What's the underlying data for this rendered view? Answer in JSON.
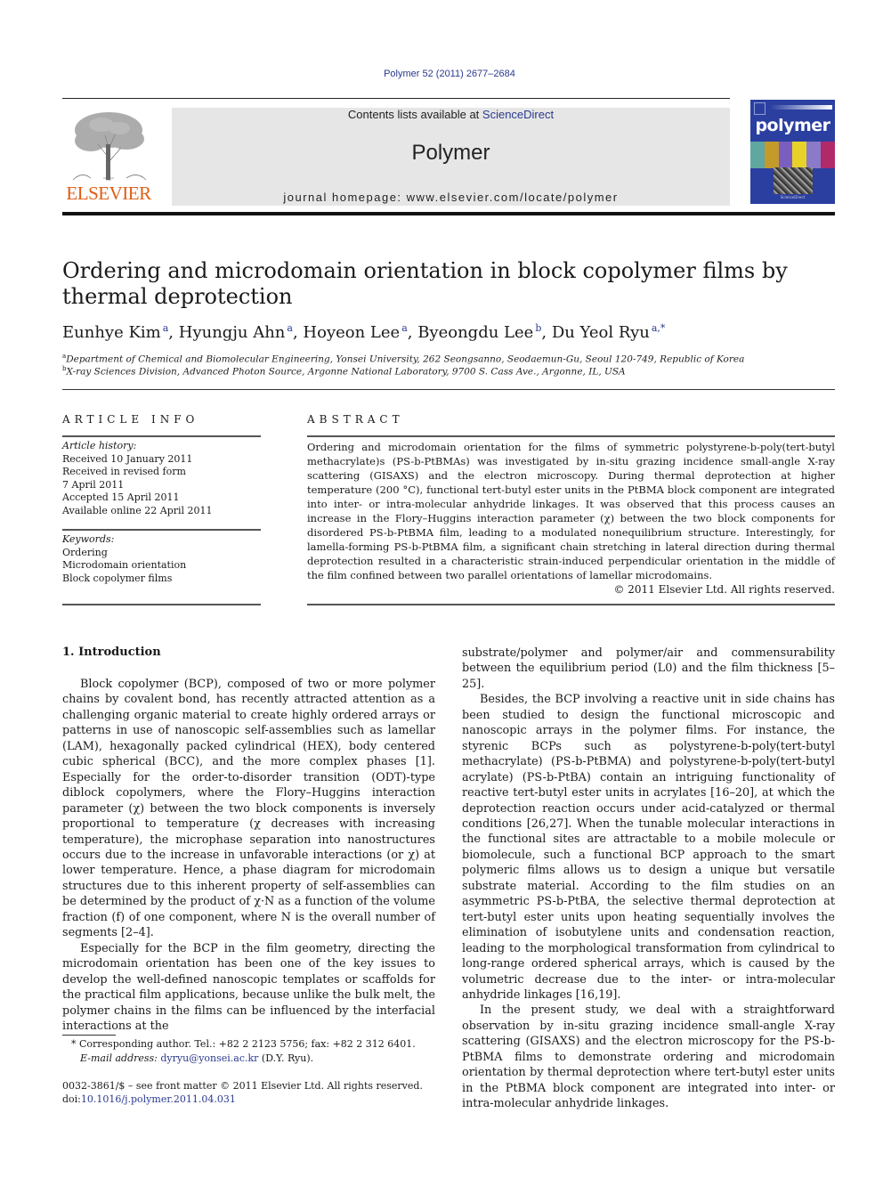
{
  "header": {
    "citation": "Polymer 52 (2011) 2677–2684",
    "contents_prefix": "Contents lists available at ",
    "contents_link": "ScienceDirect",
    "journal_title": "Polymer",
    "homepage": "journal homepage: www.elsevier.com/locate/polymer",
    "publisher_logo_text": "ELSEVIER",
    "cover_title": "polymer",
    "cover_colors": [
      "#5fa7a0",
      "#c49a2a",
      "#7b5fc0",
      "#e8d22a",
      "#8a7ac8",
      "#b02a6a"
    ]
  },
  "article": {
    "title": "Ordering and microdomain orientation in block copolymer films by thermal deprotection",
    "authors": [
      {
        "name": "Eunhye Kim",
        "sup": "a"
      },
      {
        "name": "Hyungju Ahn",
        "sup": "a"
      },
      {
        "name": "Hoyeon Lee",
        "sup": "a"
      },
      {
        "name": "Byeongdu Lee",
        "sup": "b"
      },
      {
        "name": "Du Yeol Ryu",
        "sup": "a,*"
      }
    ],
    "affiliations": [
      {
        "sup": "a",
        "text": "Department of Chemical and Biomolecular Engineering, Yonsei University, 262 Seongsanno, Seodaemun-Gu, Seoul 120-749, Republic of Korea"
      },
      {
        "sup": "b",
        "text": "X-ray Sciences Division, Advanced Photon Source, Argonne National Laboratory, 9700 S. Cass Ave., Argonne, IL, USA"
      }
    ]
  },
  "article_info": {
    "heading": "ARTICLE INFO",
    "history_label": "Article history:",
    "history": [
      "Received 10 January 2011",
      "Received in revised form",
      "7 April 2011",
      "Accepted 15 April 2011",
      "Available online 22 April 2011"
    ],
    "keywords_label": "Keywords:",
    "keywords": [
      "Ordering",
      "Microdomain orientation",
      "Block copolymer films"
    ]
  },
  "abstract": {
    "heading": "ABSTRACT",
    "text": "Ordering and microdomain orientation for the films of symmetric polystyrene-b-poly(tert-butyl methacrylate)s (PS-b-PtBMAs) was investigated by in-situ grazing incidence small-angle X-ray scattering (GISAXS) and the electron microscopy. During thermal deprotection at higher temperature (200 °C), functional tert-butyl ester units in the PtBMA block component are integrated into inter- or intra-molecular anhydride linkages. It was observed that this process causes an increase in the Flory–Huggins interaction parameter (χ) between the two block components for disordered PS-b-PtBMA film, leading to a modulated nonequilibrium structure. Interestingly, for lamella-forming PS-b-PtBMA film, a significant chain stretching in lateral direction during thermal deprotection resulted in a characteristic strain-induced perpendicular orientation in the middle of the film confined between two parallel orientations of lamellar microdomains.",
    "copyright": "© 2011 Elsevier Ltd. All rights reserved."
  },
  "body": {
    "section_title": "1.  Introduction",
    "left_paragraphs": [
      "Block copolymer (BCP), composed of two or more polymer chains by covalent bond, has recently attracted attention as a challenging organic material to create highly ordered arrays or patterns in use of nanoscopic self-assemblies such as lamellar (LAM), hexagonally packed cylindrical (HEX), body centered cubic spherical (BCC), and the more complex phases [1]. Especially for the order-to-disorder transition (ODT)-type diblock copolymers, where the Flory–Huggins interaction parameter (χ) between the two block components is inversely proportional to temperature (χ decreases with increasing temperature), the microphase separation into nanostructures occurs due to the increase in unfavorable interactions (or χ) at lower temperature. Hence, a phase diagram for microdomain structures due to this inherent property of self-assemblies can be determined by the product of χ·N as a function of the volume fraction (f) of one component, where N is the overall number of segments [2–4].",
      "Especially for the BCP in the film geometry, directing the microdomain orientation has been one of the key issues to develop the well-defined nanoscopic templates or scaffolds for the practical film applications, because unlike the bulk melt, the polymer chains in the films can be influenced by the interfacial interactions at the"
    ],
    "right_paragraphs": [
      "substrate/polymer and polymer/air and commensurability between the equilibrium period (L0) and the film thickness [5–25].",
      "Besides, the BCP involving a reactive unit in side chains has been studied to design the functional microscopic and nanoscopic arrays in the polymer films. For instance, the styrenic BCPs such as polystyrene-b-poly(tert-butyl methacrylate) (PS-b-PtBMA) and polystyrene-b-poly(tert-butyl acrylate) (PS-b-PtBA) contain an intriguing functionality of reactive tert-butyl ester units in acrylates [16–20], at which the deprotection reaction occurs under acid-catalyzed or thermal conditions [26,27]. When the tunable molecular interactions in the functional sites are attractable to a mobile molecule or biomolecule, such a functional BCP approach to the smart polymeric films allows us to design a unique but versatile substrate material. According to the film studies on an asymmetric PS-b-PtBA, the selective thermal deprotection at tert-butyl ester units upon heating sequentially involves the elimination of isobutylene units and condensation reaction, leading to the morphological transformation from cylindrical to long-range ordered spherical arrays, which is caused by the volumetric decrease due to the inter- or intra-molecular anhydride linkages [16,19].",
      "In the present study, we deal with a straightforward observation by in-situ grazing incidence small-angle X-ray scattering (GISAXS) and the electron microscopy for the PS-b-PtBMA films to demonstrate ordering and microdomain orientation by thermal deprotection where tert-butyl ester units in the PtBMA block component are integrated into inter- or intra-molecular anhydride linkages."
    ]
  },
  "footnotes": {
    "corresponding": "*  Corresponding author. Tel.: +82 2 2123 5756; fax: +82 2 312 6401.",
    "email_label": "E-mail address: ",
    "email": "dyryu@yonsei.ac.kr",
    "email_suffix": " (D.Y. Ryu).",
    "front_matter": "0032-3861/$ – see front matter © 2011 Elsevier Ltd. All rights reserved.",
    "doi_label": "doi:",
    "doi": "10.1016/j.polymer.2011.04.031"
  }
}
